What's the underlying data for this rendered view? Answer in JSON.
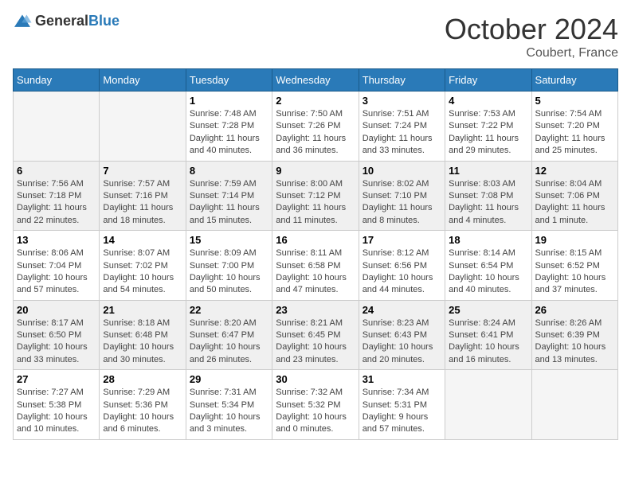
{
  "header": {
    "logo_general": "General",
    "logo_blue": "Blue",
    "month": "October 2024",
    "location": "Coubert, France"
  },
  "weekdays": [
    "Sunday",
    "Monday",
    "Tuesday",
    "Wednesday",
    "Thursday",
    "Friday",
    "Saturday"
  ],
  "weeks": [
    [
      {
        "day": "",
        "info": ""
      },
      {
        "day": "",
        "info": ""
      },
      {
        "day": "1",
        "info": "Sunrise: 7:48 AM\nSunset: 7:28 PM\nDaylight: 11 hours and 40 minutes."
      },
      {
        "day": "2",
        "info": "Sunrise: 7:50 AM\nSunset: 7:26 PM\nDaylight: 11 hours and 36 minutes."
      },
      {
        "day": "3",
        "info": "Sunrise: 7:51 AM\nSunset: 7:24 PM\nDaylight: 11 hours and 33 minutes."
      },
      {
        "day": "4",
        "info": "Sunrise: 7:53 AM\nSunset: 7:22 PM\nDaylight: 11 hours and 29 minutes."
      },
      {
        "day": "5",
        "info": "Sunrise: 7:54 AM\nSunset: 7:20 PM\nDaylight: 11 hours and 25 minutes."
      }
    ],
    [
      {
        "day": "6",
        "info": "Sunrise: 7:56 AM\nSunset: 7:18 PM\nDaylight: 11 hours and 22 minutes."
      },
      {
        "day": "7",
        "info": "Sunrise: 7:57 AM\nSunset: 7:16 PM\nDaylight: 11 hours and 18 minutes."
      },
      {
        "day": "8",
        "info": "Sunrise: 7:59 AM\nSunset: 7:14 PM\nDaylight: 11 hours and 15 minutes."
      },
      {
        "day": "9",
        "info": "Sunrise: 8:00 AM\nSunset: 7:12 PM\nDaylight: 11 hours and 11 minutes."
      },
      {
        "day": "10",
        "info": "Sunrise: 8:02 AM\nSunset: 7:10 PM\nDaylight: 11 hours and 8 minutes."
      },
      {
        "day": "11",
        "info": "Sunrise: 8:03 AM\nSunset: 7:08 PM\nDaylight: 11 hours and 4 minutes."
      },
      {
        "day": "12",
        "info": "Sunrise: 8:04 AM\nSunset: 7:06 PM\nDaylight: 11 hours and 1 minute."
      }
    ],
    [
      {
        "day": "13",
        "info": "Sunrise: 8:06 AM\nSunset: 7:04 PM\nDaylight: 10 hours and 57 minutes."
      },
      {
        "day": "14",
        "info": "Sunrise: 8:07 AM\nSunset: 7:02 PM\nDaylight: 10 hours and 54 minutes."
      },
      {
        "day": "15",
        "info": "Sunrise: 8:09 AM\nSunset: 7:00 PM\nDaylight: 10 hours and 50 minutes."
      },
      {
        "day": "16",
        "info": "Sunrise: 8:11 AM\nSunset: 6:58 PM\nDaylight: 10 hours and 47 minutes."
      },
      {
        "day": "17",
        "info": "Sunrise: 8:12 AM\nSunset: 6:56 PM\nDaylight: 10 hours and 44 minutes."
      },
      {
        "day": "18",
        "info": "Sunrise: 8:14 AM\nSunset: 6:54 PM\nDaylight: 10 hours and 40 minutes."
      },
      {
        "day": "19",
        "info": "Sunrise: 8:15 AM\nSunset: 6:52 PM\nDaylight: 10 hours and 37 minutes."
      }
    ],
    [
      {
        "day": "20",
        "info": "Sunrise: 8:17 AM\nSunset: 6:50 PM\nDaylight: 10 hours and 33 minutes."
      },
      {
        "day": "21",
        "info": "Sunrise: 8:18 AM\nSunset: 6:48 PM\nDaylight: 10 hours and 30 minutes."
      },
      {
        "day": "22",
        "info": "Sunrise: 8:20 AM\nSunset: 6:47 PM\nDaylight: 10 hours and 26 minutes."
      },
      {
        "day": "23",
        "info": "Sunrise: 8:21 AM\nSunset: 6:45 PM\nDaylight: 10 hours and 23 minutes."
      },
      {
        "day": "24",
        "info": "Sunrise: 8:23 AM\nSunset: 6:43 PM\nDaylight: 10 hours and 20 minutes."
      },
      {
        "day": "25",
        "info": "Sunrise: 8:24 AM\nSunset: 6:41 PM\nDaylight: 10 hours and 16 minutes."
      },
      {
        "day": "26",
        "info": "Sunrise: 8:26 AM\nSunset: 6:39 PM\nDaylight: 10 hours and 13 minutes."
      }
    ],
    [
      {
        "day": "27",
        "info": "Sunrise: 7:27 AM\nSunset: 5:38 PM\nDaylight: 10 hours and 10 minutes."
      },
      {
        "day": "28",
        "info": "Sunrise: 7:29 AM\nSunset: 5:36 PM\nDaylight: 10 hours and 6 minutes."
      },
      {
        "day": "29",
        "info": "Sunrise: 7:31 AM\nSunset: 5:34 PM\nDaylight: 10 hours and 3 minutes."
      },
      {
        "day": "30",
        "info": "Sunrise: 7:32 AM\nSunset: 5:32 PM\nDaylight: 10 hours and 0 minutes."
      },
      {
        "day": "31",
        "info": "Sunrise: 7:34 AM\nSunset: 5:31 PM\nDaylight: 9 hours and 57 minutes."
      },
      {
        "day": "",
        "info": ""
      },
      {
        "day": "",
        "info": ""
      }
    ]
  ]
}
